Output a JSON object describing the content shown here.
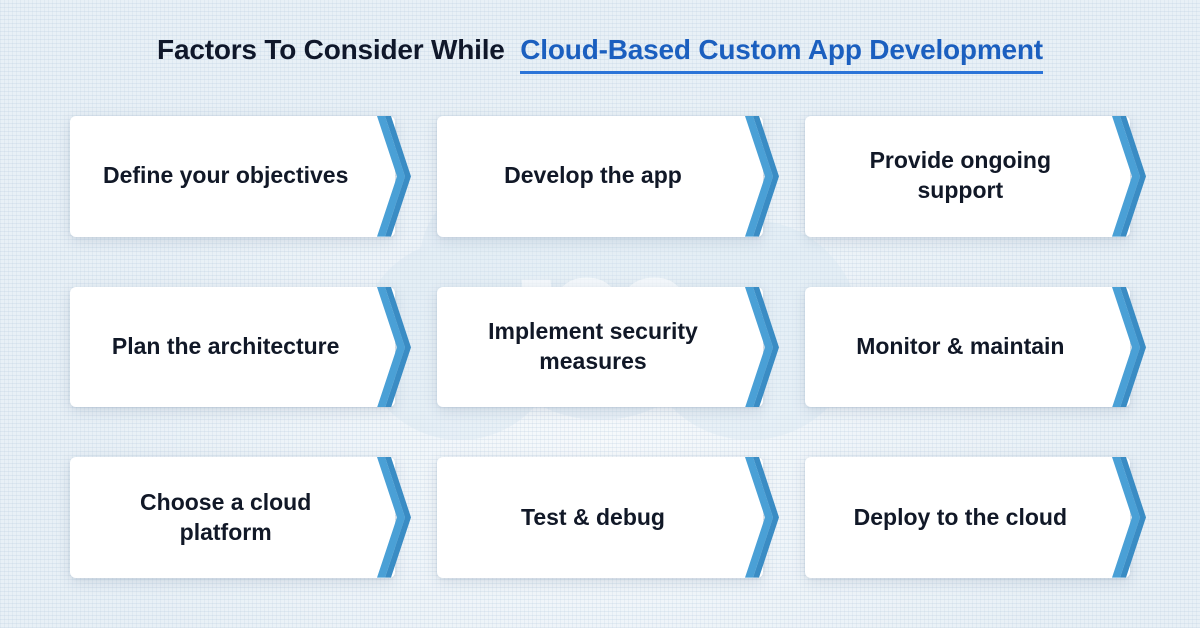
{
  "title": {
    "prefix": "Factors To Consider While",
    "highlight": "Cloud-Based Custom App Development"
  },
  "colors": {
    "arrow_fill": "#4aa0d6",
    "arrow_edge": "#3a8cc4",
    "highlight_text": "#1b5fbf"
  },
  "cards": [
    {
      "label": "Define your objectives"
    },
    {
      "label": "Develop the app"
    },
    {
      "label": "Provide ongoing support"
    },
    {
      "label": "Plan the architecture"
    },
    {
      "label": "Implement security measures"
    },
    {
      "label": "Monitor & maintain"
    },
    {
      "label": "Choose a cloud platform"
    },
    {
      "label": "Test & debug"
    },
    {
      "label": "Deploy to the cloud"
    }
  ]
}
